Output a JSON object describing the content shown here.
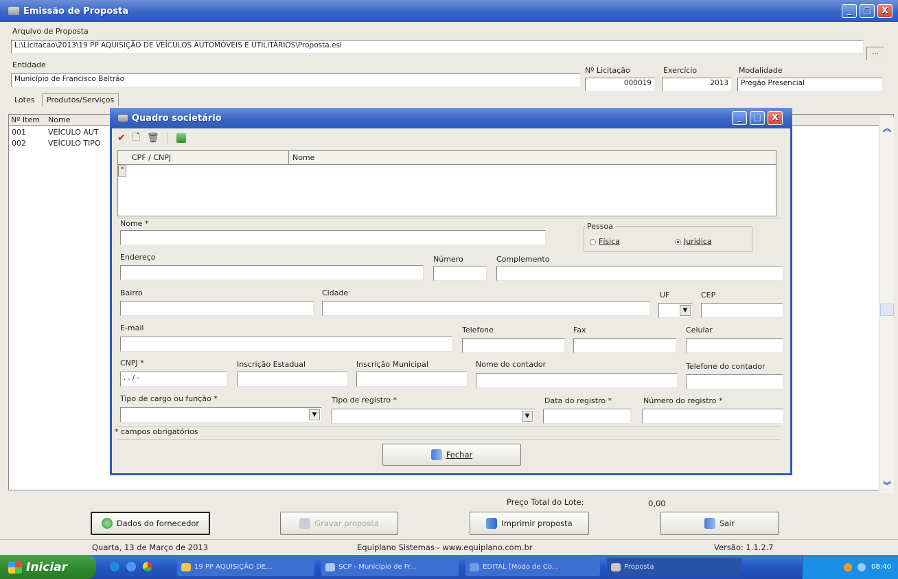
{
  "window": {
    "title": "Emissão de Proposta",
    "minimize": "_",
    "maximize": "□",
    "close": "X"
  },
  "arquivo": {
    "label": "Arquivo de Proposta",
    "value": "L:\\Licitacao\\2013\\19 PP AQUISIÇÃO DE VEÍCULOS AUTOMÓVEIS E UTILITÁRIOS\\Proposta.esl",
    "browse": "..."
  },
  "entidade": {
    "label": "Entidade",
    "value": "Município de Francisco Beltrão"
  },
  "licitacao": {
    "label": "Nº Licitação",
    "value": "000019"
  },
  "exercicio": {
    "label": "Exercício",
    "value": "2013"
  },
  "modalidade": {
    "label": "Modalidade",
    "value": "Pregão Presencial"
  },
  "tabs": [
    "Lotes",
    "Produtos/Serviços"
  ],
  "grid": {
    "headers": [
      "Nº Item",
      "Nome"
    ],
    "rows": [
      [
        "001",
        "VEÍCULO AUT"
      ],
      [
        "002",
        "VEÍCULO TIPO"
      ]
    ]
  },
  "total": {
    "label": "Preço Total do Lote:",
    "value": "0,00"
  },
  "buttons": {
    "fornecedor": "Dados do fornecedor",
    "gravar": "Gravar proposta",
    "imprimir": "Imprimir proposta",
    "sair": "Sair"
  },
  "status": {
    "date": "Quarta, 13 de Março de 2013",
    "company": "Equiplano Sistemas - www.equiplano.com.br",
    "version": "Versão: 1.1.2.7"
  },
  "taskbar": {
    "start": "Iniciar",
    "items": [
      "19 PP AQUISIÇÃO DE...",
      "SCP - Município de Fr...",
      "EDITAL [Modo de Co...",
      "Proposta"
    ],
    "clock": "08:40"
  },
  "dialog": {
    "title": "Quadro societário",
    "grid_headers": [
      "CPF / CNPJ",
      "Nome"
    ],
    "nome_label": "Nome *",
    "pessoa_label": "Pessoa",
    "fisica": "Física",
    "juridica": "Jurídica",
    "endereco": "Endereço",
    "numero": "Número",
    "complemento": "Complemento",
    "bairro": "Bairro",
    "cidade": "Cidade",
    "uf": "UF",
    "cep": "CEP",
    "email": "E-mail",
    "telefone": "Telefone",
    "fax": "Fax",
    "celular": "Celular",
    "cnpj": "CNPJ *",
    "cnpj_mask": " .   .   /   -",
    "inscricao_estadual": "Inscrição Estadual",
    "inscricao_municipal": "Inscrição Municipal",
    "nome_contador": "Nome do contador",
    "telefone_contador": "Telefone do contador",
    "tipo_cargo": "Tipo de cargo ou função *",
    "tipo_registro": "Tipo de registro *",
    "data_registro": "Data do registro *",
    "numero_registro": "Número do registro *",
    "obrigatorios": "* campos obrigatórios",
    "fechar": "Fechar"
  }
}
